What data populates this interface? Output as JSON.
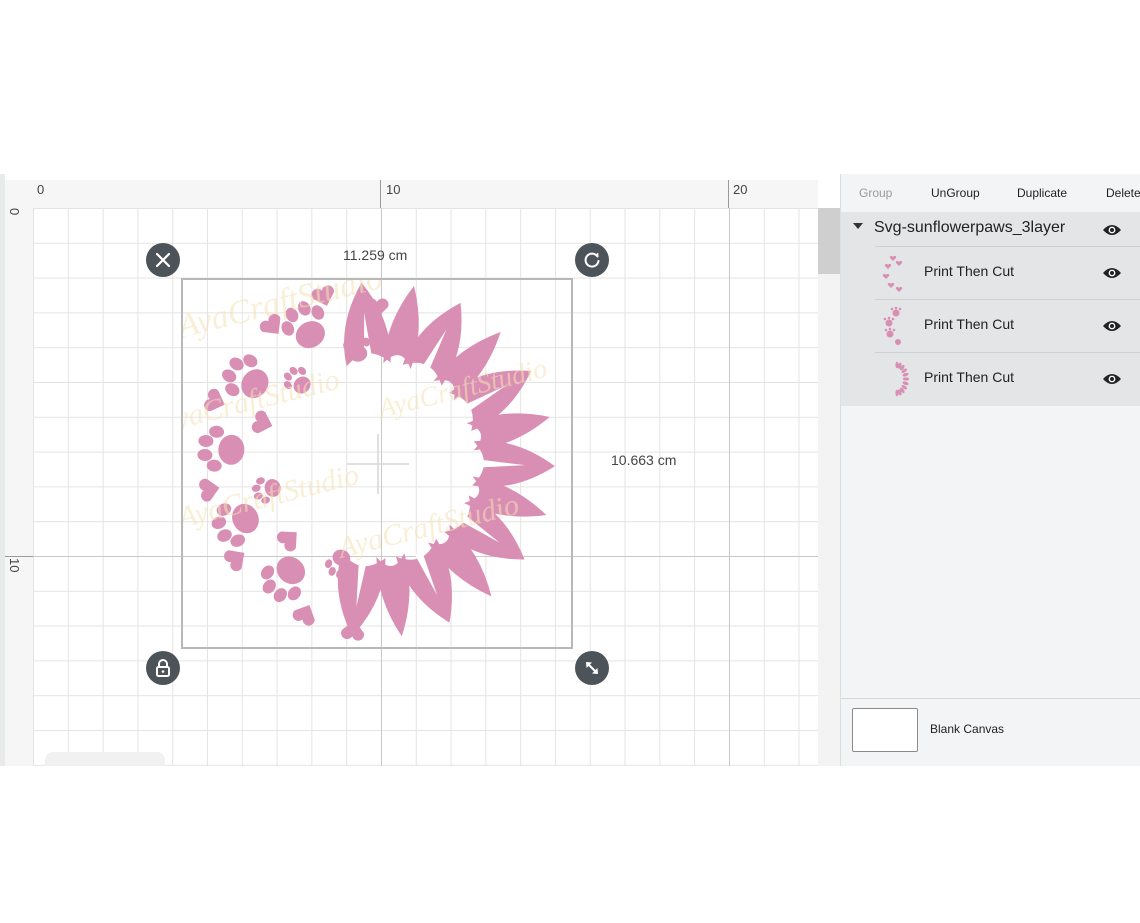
{
  "ruler": {
    "top_labels": [
      "0",
      "10",
      "20"
    ],
    "left_labels": [
      "0",
      "10"
    ]
  },
  "selection": {
    "width_label": "11.259 cm",
    "height_label": "10.663 cm",
    "handles": {
      "delete": "close-icon",
      "rotate": "rotate-icon",
      "lock": "lock-icon",
      "resize": "resize-icon"
    }
  },
  "design": {
    "fill_color": "#d98fb4",
    "watermark_color": "#f5e3b5",
    "watermark_text": "AyaCraftStudio"
  },
  "panel": {
    "toolbar": {
      "group": "Group",
      "ungroup": "UnGroup",
      "duplicate": "Duplicate",
      "delete": "Delete"
    },
    "group_name": "Svg-sunflowerpaws_3layer",
    "layers": [
      {
        "label": "Print Then Cut",
        "thumb": "hearts-paws"
      },
      {
        "label": "Print Then Cut",
        "thumb": "paw-prints"
      },
      {
        "label": "Print Then Cut",
        "thumb": "sunflower-petals"
      }
    ],
    "blank_canvas_label": "Blank Canvas"
  },
  "colors": {
    "accent_pink": "#d98fb4",
    "handle_dark": "#4c5359",
    "panel_bg": "#f3f4f6",
    "layer_bg": "#e4e5e7"
  }
}
